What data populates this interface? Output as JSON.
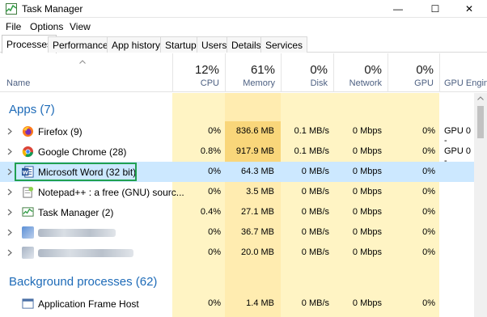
{
  "window": {
    "title": "Task Manager",
    "controls": {
      "minimize": "—",
      "maximize": "☐",
      "close": "✕"
    }
  },
  "menu": [
    "File",
    "Options",
    "View"
  ],
  "tabs": [
    "Processes",
    "Performance",
    "App history",
    "Startup",
    "Users",
    "Details",
    "Services"
  ],
  "active_tab": "Processes",
  "columns": {
    "name": "Name",
    "cpu": {
      "pct": "12%",
      "label": "CPU"
    },
    "memory": {
      "pct": "61%",
      "label": "Memory"
    },
    "disk": {
      "pct": "0%",
      "label": "Disk"
    },
    "network": {
      "pct": "0%",
      "label": "Network"
    },
    "gpu": {
      "pct": "0%",
      "label": "GPU"
    },
    "gpu_engine": {
      "label": "GPU Engine"
    }
  },
  "groups": {
    "apps": "Apps (7)",
    "background": "Background processes (62)"
  },
  "apps": [
    {
      "icon": "firefox-icon",
      "name": "Firefox (9)",
      "cpu": "0%",
      "memory": "836.6 MB",
      "disk": "0.1 MB/s",
      "network": "0 Mbps",
      "gpu": "0%",
      "gpu_engine": "GPU 0 -"
    },
    {
      "icon": "chrome-icon",
      "name": "Google Chrome (28)",
      "cpu": "0.8%",
      "memory": "917.9 MB",
      "disk": "0.1 MB/s",
      "network": "0 Mbps",
      "gpu": "0%",
      "gpu_engine": "GPU 0 -"
    },
    {
      "icon": "word-icon",
      "name": "Microsoft Word (32 bit)",
      "cpu": "0%",
      "memory": "64.3 MB",
      "disk": "0 MB/s",
      "network": "0 Mbps",
      "gpu": "0%",
      "gpu_engine": ""
    },
    {
      "icon": "notepad-plus-plus-icon",
      "name": "Notepad++ : a free (GNU) sourc...",
      "cpu": "0%",
      "memory": "3.5 MB",
      "disk": "0 MB/s",
      "network": "0 Mbps",
      "gpu": "0%",
      "gpu_engine": ""
    },
    {
      "icon": "task-manager-icon",
      "name": "Task Manager (2)",
      "cpu": "0.4%",
      "memory": "27.1 MB",
      "disk": "0 MB/s",
      "network": "0 Mbps",
      "gpu": "0%",
      "gpu_engine": ""
    },
    {
      "icon": "blurred-app-icon",
      "name": "",
      "cpu": "0%",
      "memory": "36.7 MB",
      "disk": "0 MB/s",
      "network": "0 Mbps",
      "gpu": "0%",
      "gpu_engine": ""
    },
    {
      "icon": "blurred-app-icon",
      "name": "",
      "cpu": "0%",
      "memory": "20.0 MB",
      "disk": "0 MB/s",
      "network": "0 Mbps",
      "gpu": "0%",
      "gpu_engine": ""
    }
  ],
  "background": [
    {
      "icon": "application-frame-host-icon",
      "name": "Application Frame Host",
      "cpu": "0%",
      "memory": "1.4 MB",
      "disk": "0 MB/s",
      "network": "0 Mbps",
      "gpu": "0%",
      "gpu_engine": ""
    }
  ],
  "colors": {
    "heat_light": "#fff4c4",
    "heat_mid": "#ffe8a0",
    "heat_strong": "#f9d67a",
    "selected_row": "#cce8ff",
    "group_title": "#1e6bb8",
    "highlight_box": "#20a050"
  }
}
